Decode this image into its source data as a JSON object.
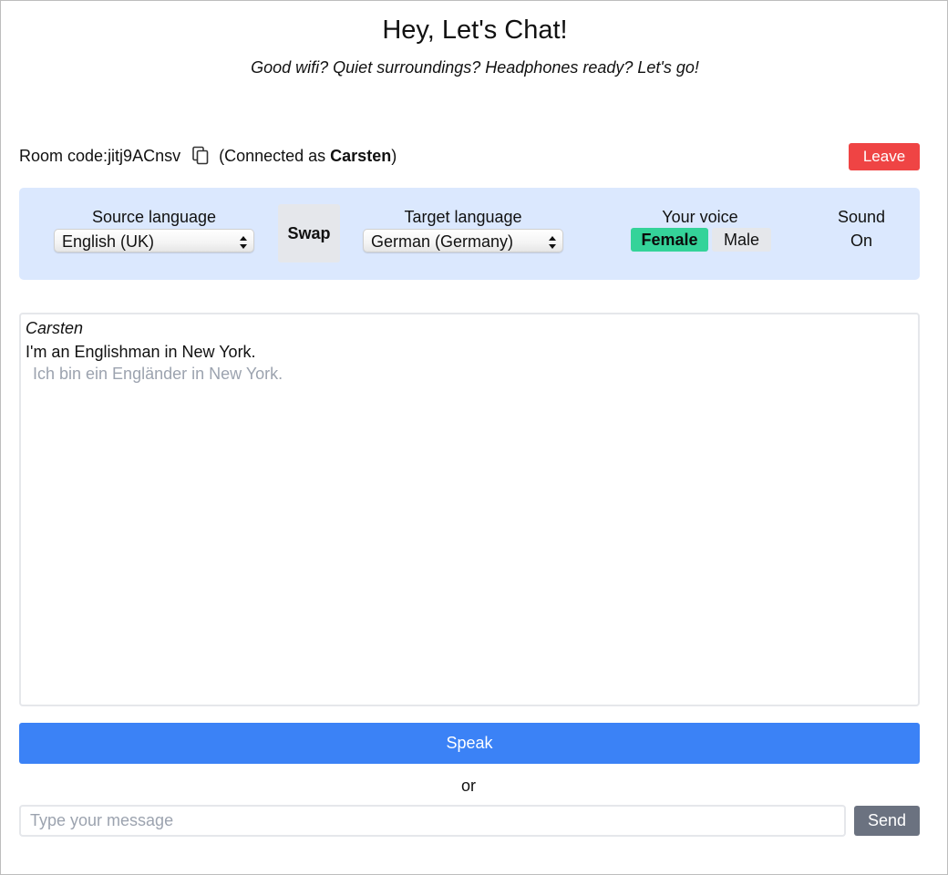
{
  "header": {
    "title": "Hey, Let's Chat!",
    "subtitle": "Good wifi? Quiet surroundings? Headphones ready? Let's go!"
  },
  "room": {
    "label": "Room code:",
    "code": "jitj9ACnsv",
    "connected_prefix": "(Connected as ",
    "user": "Carsten",
    "connected_suffix": ")",
    "leave_label": "Leave",
    "copy_icon": "copy-icon"
  },
  "settings": {
    "source_label": "Source language",
    "source_value": "English (UK)",
    "swap_label": "Swap",
    "target_label": "Target language",
    "target_value": "German (Germany)",
    "voice_label": "Your voice",
    "voice_options": [
      "Female",
      "Male"
    ],
    "voice_selected": "Female",
    "sound_label": "Sound",
    "sound_value": "On"
  },
  "chat": {
    "messages": [
      {
        "sender": "Carsten",
        "text": "I'm an Englishman in New York.",
        "translation": "Ich bin ein Engländer in New York."
      }
    ]
  },
  "controls": {
    "speak_label": "Speak",
    "or_label": "or",
    "input_placeholder": "Type your message",
    "input_value": "",
    "send_label": "Send"
  },
  "colors": {
    "leave": "#ef4444",
    "settings_bg": "#dbe8fe",
    "voice_selected": "#34d399",
    "speak": "#3b82f6",
    "send": "#6b7280",
    "translation_text": "#9ca3af"
  }
}
